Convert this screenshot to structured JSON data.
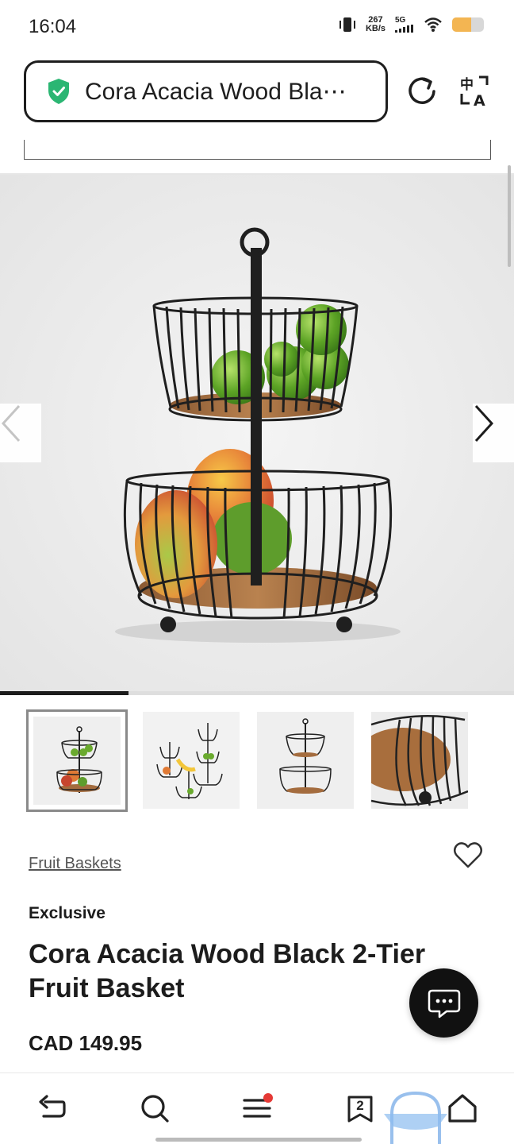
{
  "status_bar": {
    "time": "16:04",
    "net_speed_value": "267",
    "net_speed_unit": "KB/s",
    "network_type": "5G",
    "battery_level": 0.6
  },
  "browser": {
    "url_text": "Cora Acacia Wood Bla⋯",
    "shield_color": "#2bb673"
  },
  "gallery": {
    "image_count": 4,
    "current_index": 1,
    "progress_fraction": 0.25
  },
  "thumbnails": [
    {
      "name": "thumb-1"
    },
    {
      "name": "thumb-2"
    },
    {
      "name": "thumb-3"
    },
    {
      "name": "thumb-4"
    }
  ],
  "product": {
    "breadcrumb": "Fruit Baskets",
    "badge": "Exclusive",
    "title": "Cora Acacia Wood Black 2-Tier Fruit Basket",
    "price": "CAD 149.95"
  },
  "bottom_nav": {
    "tabs_count": "2",
    "items": [
      "back-icon",
      "search-icon",
      "menu-icon",
      "tabs-icon",
      "home-icon"
    ],
    "menu_badge_color": "#e53935"
  }
}
